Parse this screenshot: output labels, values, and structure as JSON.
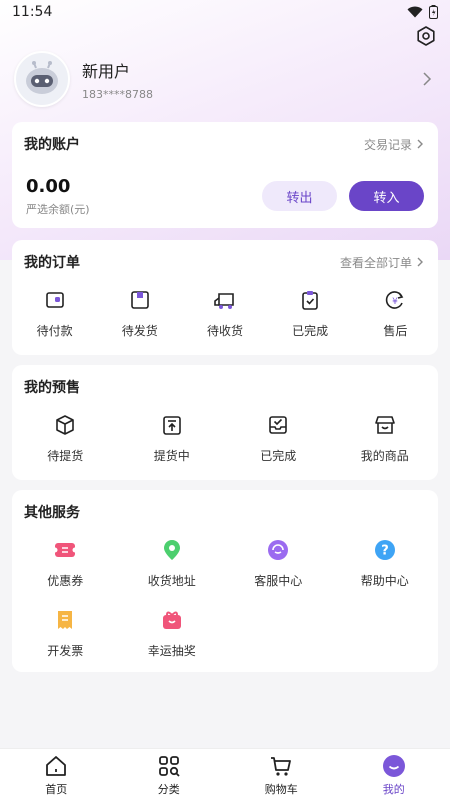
{
  "status_bar": {
    "time": "11:54"
  },
  "profile": {
    "name": "新用户",
    "phone": "183****8788"
  },
  "account": {
    "title": "我的账户",
    "link": "交易记录",
    "balance": "0.00",
    "balance_label": "严选余额(元)",
    "withdraw_label": "转出",
    "deposit_label": "转入"
  },
  "orders": {
    "title": "我的订单",
    "link": "查看全部订单",
    "items": [
      {
        "label": "待付款",
        "icon": "wallet-icon"
      },
      {
        "label": "待发货",
        "icon": "package-icon"
      },
      {
        "label": "待收货",
        "icon": "truck-icon"
      },
      {
        "label": "已完成",
        "icon": "clipboard-check-icon"
      },
      {
        "label": "售后",
        "icon": "yen-refresh-icon"
      }
    ]
  },
  "presale": {
    "title": "我的预售",
    "items": [
      {
        "label": "待提货",
        "icon": "box-icon"
      },
      {
        "label": "提货中",
        "icon": "upload-box-icon"
      },
      {
        "label": "已完成",
        "icon": "inbox-check-icon"
      },
      {
        "label": "我的商品",
        "icon": "store-icon"
      }
    ]
  },
  "services": {
    "title": "其他服务",
    "items": [
      {
        "label": "优惠券",
        "icon": "coupon-icon"
      },
      {
        "label": "收货地址",
        "icon": "location-icon"
      },
      {
        "label": "客服中心",
        "icon": "customer-service-icon"
      },
      {
        "label": "帮助中心",
        "icon": "help-icon"
      },
      {
        "label": "开发票",
        "icon": "invoice-icon"
      },
      {
        "label": "幸运抽奖",
        "icon": "gift-icon"
      }
    ]
  },
  "tabbar": {
    "items": [
      {
        "label": "首页",
        "icon": "home-icon"
      },
      {
        "label": "分类",
        "icon": "category-icon"
      },
      {
        "label": "购物车",
        "icon": "cart-icon"
      },
      {
        "label": "我的",
        "icon": "profile-icon"
      }
    ],
    "active_index": 3
  },
  "colors": {
    "accent": "#6a45c8",
    "accent_light": "#efe9fb",
    "background": "#f5f5f7"
  }
}
